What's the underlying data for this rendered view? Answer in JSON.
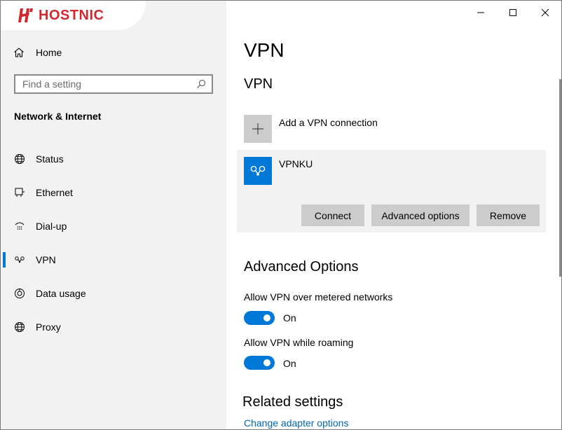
{
  "brand": {
    "name": "HOSTNIC",
    "color": "#d0282e"
  },
  "window_controls": {
    "minimize_icon": "minimize-icon",
    "maximize_icon": "maximize-icon",
    "close_icon": "close-icon"
  },
  "nav": {
    "home_label": "Home",
    "search_placeholder": "Find a setting",
    "section_title": "Network & Internet",
    "items": [
      {
        "label": "Status",
        "icon": "globe-icon"
      },
      {
        "label": "Ethernet",
        "icon": "ethernet-icon"
      },
      {
        "label": "Dial-up",
        "icon": "dial-up-icon"
      },
      {
        "label": "VPN",
        "icon": "vpn-icon",
        "selected": true
      },
      {
        "label": "Data usage",
        "icon": "data-usage-icon"
      },
      {
        "label": "Proxy",
        "icon": "globe-icon"
      }
    ]
  },
  "main": {
    "page_title": "VPN",
    "section_title": "VPN",
    "add_vpn_label": "Add a VPN connection",
    "connection": {
      "name": "VPNKU",
      "connect_label": "Connect",
      "advanced_label": "Advanced options",
      "remove_label": "Remove"
    },
    "advanced": {
      "title": "Advanced Options",
      "options": [
        {
          "label": "Allow VPN over metered networks",
          "state": "On",
          "enabled": true
        },
        {
          "label": "Allow VPN while roaming",
          "state": "On",
          "enabled": true
        }
      ]
    },
    "related": {
      "title": "Related settings",
      "link": "Change adapter options"
    }
  },
  "colors": {
    "accent": "#0078d7",
    "link": "#0066b4",
    "nav_bg": "#f2f2f2",
    "button_bg": "#cccccc"
  }
}
